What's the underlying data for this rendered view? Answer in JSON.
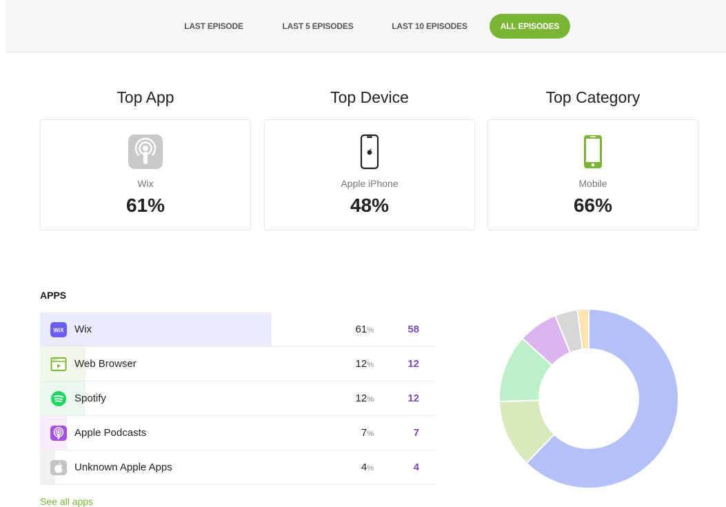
{
  "tabs": [
    {
      "label": "LAST EPISODE",
      "active": false
    },
    {
      "label": "LAST 5 EPISODES",
      "active": false
    },
    {
      "label": "LAST 10 EPISODES",
      "active": false
    },
    {
      "label": "ALL EPISODES",
      "active": true
    }
  ],
  "stats": {
    "top_app": {
      "title": "Top App",
      "name": "Wix",
      "percent": "61%",
      "icon": "podcast-icon"
    },
    "top_device": {
      "title": "Top Device",
      "name": "Apple iPhone",
      "percent": "48%",
      "icon": "iphone-icon"
    },
    "top_category": {
      "title": "Top Category",
      "name": "Mobile",
      "percent": "66%",
      "icon": "mobile-icon"
    }
  },
  "apps": {
    "heading": "APPS",
    "rows": [
      {
        "name": "Wix",
        "pct": "61",
        "unit": "%",
        "count": "58",
        "icon": "wix-icon",
        "share": 61,
        "bar_color": "#e9ecfc"
      },
      {
        "name": "Web Browser",
        "pct": "12",
        "unit": "%",
        "count": "12",
        "icon": "web-browser-icon",
        "share": 12,
        "bar_color": "#f3f8ec"
      },
      {
        "name": "Spotify",
        "pct": "12",
        "unit": "%",
        "count": "12",
        "icon": "spotify-icon",
        "share": 12,
        "bar_color": "#ecf8ef"
      },
      {
        "name": "Apple Podcasts",
        "pct": "7",
        "unit": "%",
        "count": "7",
        "icon": "apple-podcasts-icon",
        "share": 7,
        "bar_color": "#f6ecfa"
      },
      {
        "name": "Unknown Apple Apps",
        "pct": "4",
        "unit": "%",
        "count": "4",
        "icon": "apple-icon",
        "share": 4,
        "bar_color": "#f1f1f1"
      }
    ],
    "see_all": "See all apps"
  },
  "chart_data": {
    "type": "pie",
    "variant": "donut",
    "values": [
      61,
      12,
      12,
      7,
      4,
      2
    ],
    "colors": [
      "#b4c0f8",
      "#d8e9bc",
      "#bdf0c8",
      "#dcb4ee",
      "#d7d7d7",
      "#fde3b0"
    ]
  },
  "colors": {
    "accent": "#7ab536",
    "count": "#7e4bb5"
  }
}
